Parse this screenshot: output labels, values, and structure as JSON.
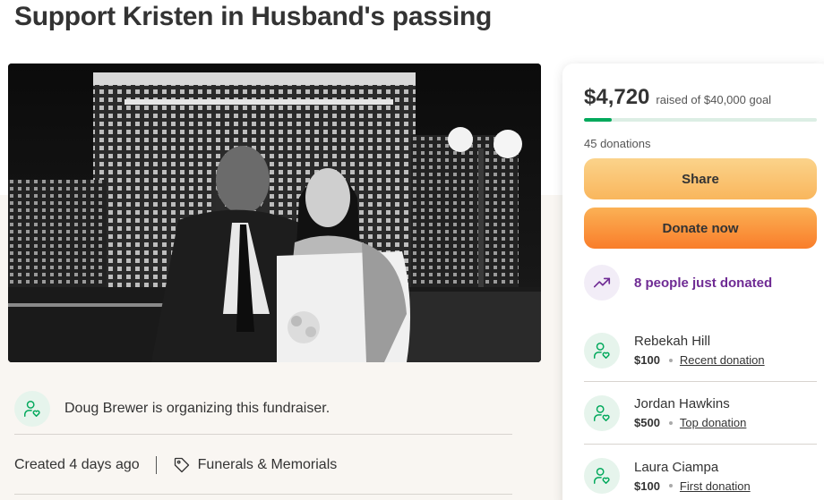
{
  "page_title": "Support Kristen in Husband's passing",
  "organizer": {
    "text": "Doug Brewer is organizing this fundraiser.",
    "icon": "person-heart-icon"
  },
  "meta": {
    "created": "Created 4 days ago",
    "category": "Funerals & Memorials",
    "category_icon": "tag-icon"
  },
  "campaign_photo": {
    "alt": "Couple photo in front of Bellagio at night"
  },
  "donation_card": {
    "raised_amount": "$4,720",
    "goal_text": "raised of $40,000 goal",
    "progress_fraction": 0.118,
    "donations_count": "45 donations",
    "share_label": "Share",
    "donate_label": "Donate now",
    "just_donated": "8 people just donated",
    "donors": [
      {
        "name": "Rebekah Hill",
        "amount": "$100",
        "tag": "Recent donation"
      },
      {
        "name": "Jordan Hawkins",
        "amount": "$500",
        "tag": "Top donation"
      },
      {
        "name": "Laura Ciampa",
        "amount": "$100",
        "tag": "First donation"
      }
    ]
  },
  "colors": {
    "brand_green": "#02a95c",
    "accent_purple": "#6f2b94",
    "donate_orange": "#f97d2a"
  }
}
